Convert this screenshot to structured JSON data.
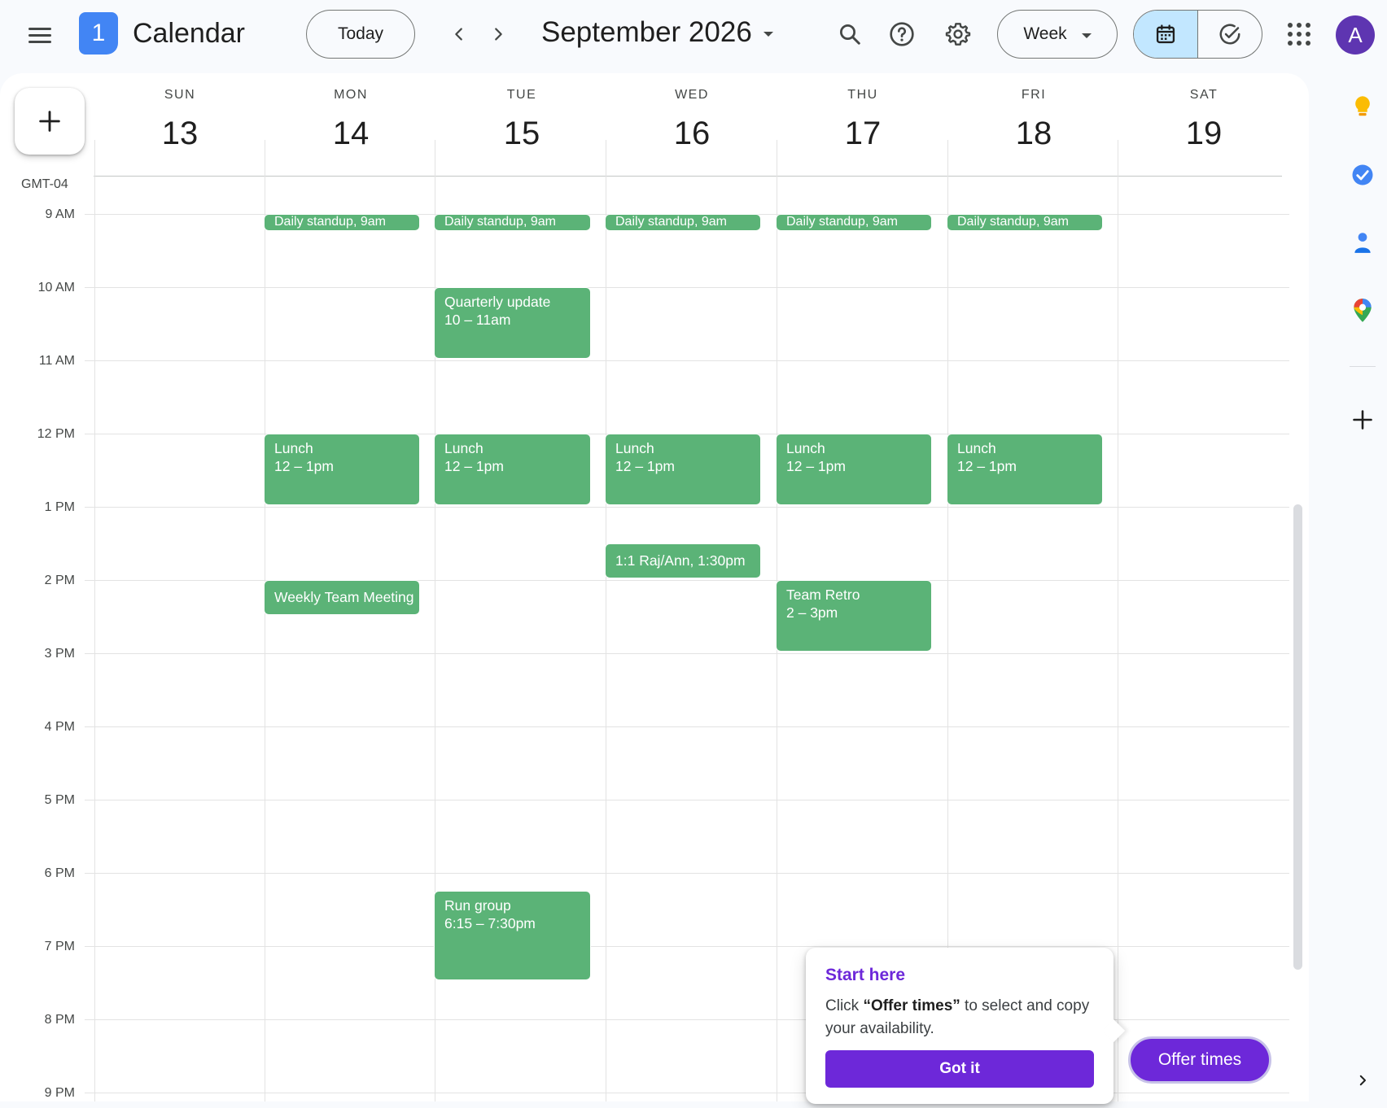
{
  "header": {
    "logo_text": "1",
    "app_title": "Calendar",
    "today_label": "Today",
    "month_title": "September 2026",
    "view_label": "Week",
    "avatar_letter": "A"
  },
  "timezone": "GMT-04",
  "days": [
    {
      "dow": "SUN",
      "num": "13"
    },
    {
      "dow": "MON",
      "num": "14"
    },
    {
      "dow": "TUE",
      "num": "15"
    },
    {
      "dow": "WED",
      "num": "16"
    },
    {
      "dow": "THU",
      "num": "17"
    },
    {
      "dow": "FRI",
      "num": "18"
    },
    {
      "dow": "SAT",
      "num": "19"
    }
  ],
  "hours": [
    "9 AM",
    "10 AM",
    "11 AM",
    "12 PM",
    "1 PM",
    "2 PM",
    "3 PM",
    "4 PM",
    "5 PM",
    "6 PM",
    "7 PM",
    "8 PM",
    "9 PM"
  ],
  "events": {
    "standup": "Daily standup, 9am",
    "quarterly": {
      "title": "Quarterly update",
      "time": "10 – 11am"
    },
    "lunch": {
      "title": "Lunch",
      "time": "12 – 1pm"
    },
    "one_on_one": "1:1 Raj/Ann, 1:30pm",
    "weekly": "Weekly Team Meeting",
    "retro": {
      "title": "Team Retro",
      "time": "2 – 3pm"
    },
    "run": {
      "title": "Run group",
      "time": "6:15 – 7:30pm"
    }
  },
  "popover": {
    "title": "Start here",
    "body_prefix": "Click ",
    "body_bold": "“Offer times”",
    "body_suffix": " to select and copy your availability.",
    "button": "Got it"
  },
  "offer_button": "Offer times",
  "colors": {
    "event": "#5bb377",
    "accent_purple": "#6d28d9",
    "selected_toggle": "#c2e7ff",
    "brand_blue": "#4285f4"
  }
}
